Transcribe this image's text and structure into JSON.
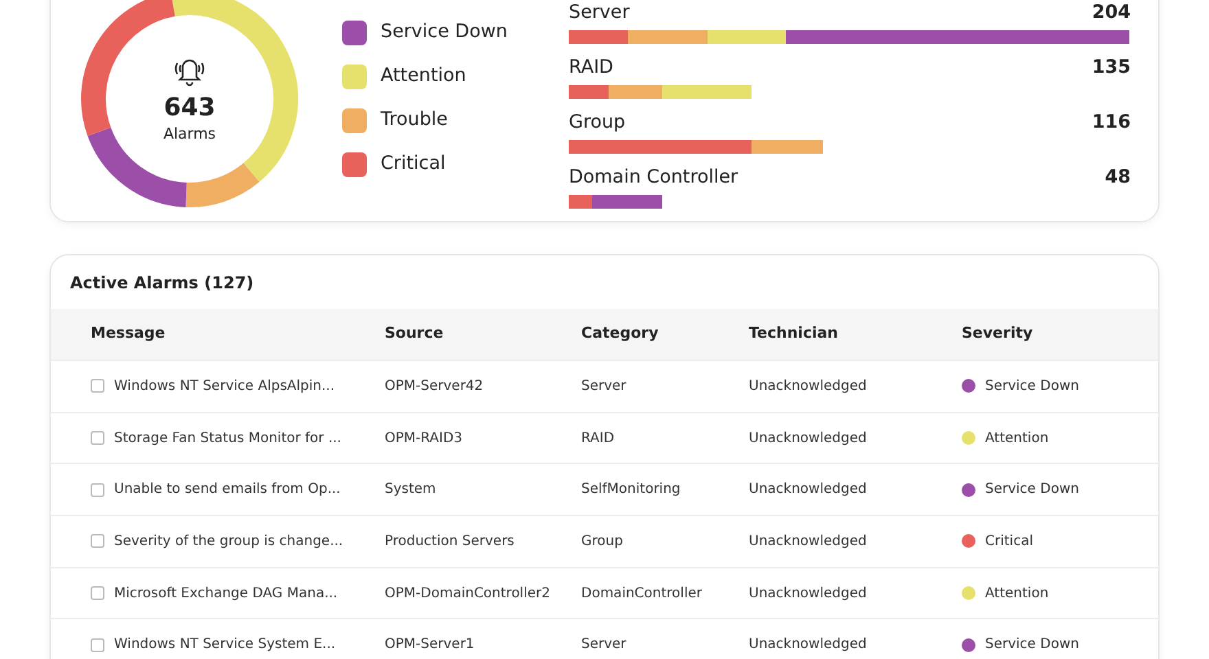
{
  "summary": {
    "total": "643",
    "total_label": "Alarms",
    "legend": [
      {
        "label": "Service Down",
        "color": "#9c4fa9"
      },
      {
        "label": "Attention",
        "color": "#e6e16c"
      },
      {
        "label": "Trouble",
        "color": "#efae62"
      },
      {
        "label": "Critical",
        "color": "#e8615b"
      }
    ],
    "categories": [
      {
        "name": "Server",
        "count": "204",
        "segments": [
          {
            "color": "#e8615b"
          },
          {
            "color": "#efae62"
          },
          {
            "color": "#e6e16c"
          },
          {
            "color": "#9c4fa9"
          }
        ]
      },
      {
        "name": "RAID",
        "count": "135",
        "segments": [
          {
            "color": "#e8615b"
          },
          {
            "color": "#efae62"
          },
          {
            "color": "#e6e16c"
          }
        ]
      },
      {
        "name": "Group",
        "count": "116",
        "segments": [
          {
            "color": "#e8615b"
          },
          {
            "color": "#efae62"
          }
        ]
      },
      {
        "name": "Domain Controller",
        "count": "48",
        "segments": [
          {
            "color": "#e8615b"
          },
          {
            "color": "#9c4fa9"
          }
        ]
      }
    ]
  },
  "alarms": {
    "title": "Active Alarms (127)",
    "columns": [
      "Message",
      "Source",
      "Category",
      "Technician",
      "Severity"
    ],
    "rows": [
      {
        "checked": false,
        "message": "Windows NT Service AlpsAlpin...",
        "source": "OPM-Server42",
        "category": "Server",
        "technician": "Unacknowledged",
        "severity": "Service Down",
        "color": "#9c4fa9"
      },
      {
        "checked": false,
        "message": "Storage Fan Status Monitor for ...",
        "source": "OPM-RAID3",
        "category": "RAID",
        "technician": "Unacknowledged",
        "severity": "Attention",
        "color": "#e6e16c"
      },
      {
        "checked": false,
        "message": "Unable to send emails from Op...",
        "source": "System",
        "category": "SelfMonitoring",
        "technician": "Unacknowledged",
        "severity": "Service Down",
        "color": "#9c4fa9"
      },
      {
        "checked": false,
        "message": "Severity of the group is change...",
        "source": "Production Servers",
        "category": "Group",
        "technician": "Unacknowledged",
        "severity": "Critical",
        "color": "#e8615b"
      },
      {
        "checked": false,
        "message": "Microsoft Exchange DAG Mana...",
        "source": "OPM-DomainController2",
        "category": "DomainController",
        "technician": "Unacknowledged",
        "severity": "Attention",
        "color": "#e6e16c"
      },
      {
        "checked": false,
        "message": "Windows NT Service System E...",
        "source": "OPM-Server1",
        "category": "Server",
        "technician": "Unacknowledged",
        "severity": "Service Down",
        "color": "#9c4fa9"
      }
    ]
  }
}
